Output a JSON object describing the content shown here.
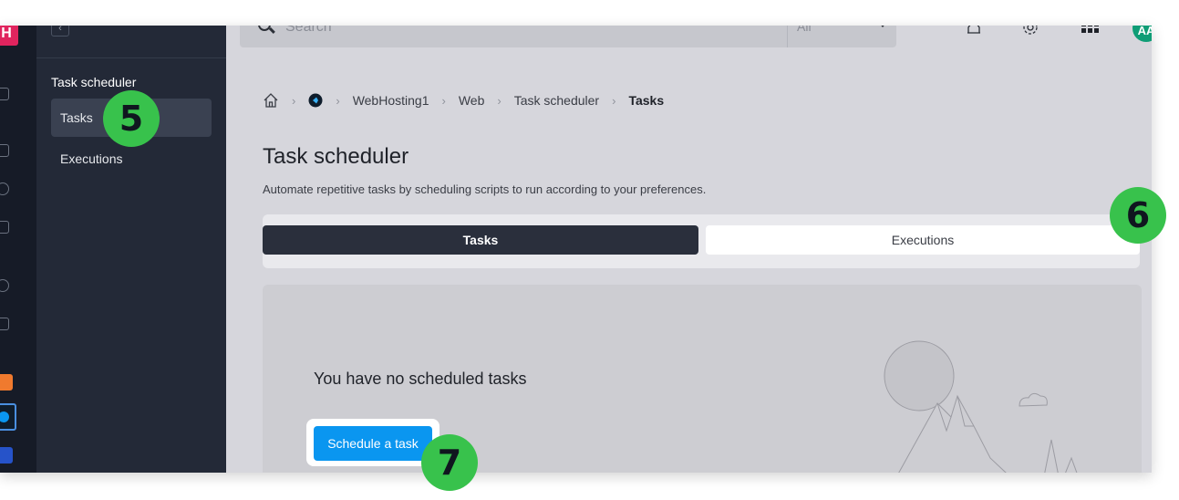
{
  "rail": {
    "logo_text": "H"
  },
  "sidebar": {
    "collapse_icon": "chevron-left-icon",
    "section_title": "Task scheduler",
    "items": [
      {
        "label": "Tasks",
        "active": true
      },
      {
        "label": "Executions",
        "active": false
      }
    ]
  },
  "topbar": {
    "search_placeholder": "Search",
    "scope_value": "All",
    "icons": [
      "bell-icon",
      "gear-icon",
      "apps-grid-icon"
    ],
    "avatar_initials": "AA"
  },
  "breadcrumb": {
    "items": [
      "WebHosting1",
      "Web",
      "Task scheduler",
      "Tasks"
    ]
  },
  "page": {
    "title": "Task scheduler",
    "subtitle": "Automate repetitive tasks by scheduling scripts to run according to your preferences."
  },
  "tabs": [
    {
      "label": "Tasks",
      "active": true
    },
    {
      "label": "Executions",
      "active": false
    }
  ],
  "empty_state": {
    "message": "You have no scheduled tasks",
    "button_label": "Schedule a task"
  },
  "callouts": [
    "5",
    "6",
    "7"
  ],
  "colors": {
    "accent": "#0a96f0",
    "callout": "#38c24c",
    "sidebar_bg": "#232937"
  }
}
